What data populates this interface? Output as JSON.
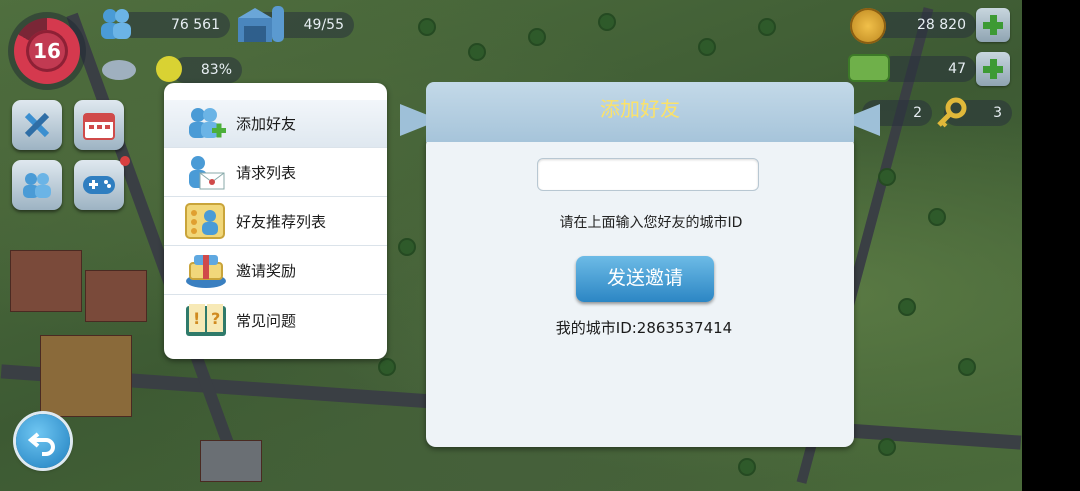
{
  "hud": {
    "level": "16",
    "population": "76 561",
    "storage": "49/55",
    "happiness": "83%",
    "simoleons": "28 820",
    "simcash": "47",
    "golden_keys": "2",
    "keys": "3"
  },
  "menu": {
    "items": [
      {
        "label": "添加好友",
        "icon": "add-friend-icon"
      },
      {
        "label": "请求列表",
        "icon": "request-list-icon"
      },
      {
        "label": "好友推荐列表",
        "icon": "recommend-list-icon"
      },
      {
        "label": "邀请奖励",
        "icon": "invite-reward-icon"
      },
      {
        "label": "常见问题",
        "icon": "faq-book-icon"
      }
    ],
    "active_index": 0
  },
  "dialog": {
    "title": "添加好友",
    "input_value": "",
    "hint": "请在上面输入您好友的城市ID",
    "send_label": "发送邀请",
    "my_city_id": "我的城市ID:2863537414"
  },
  "colors": {
    "title_text": "#fbe26a",
    "send_button": "#2c86c4",
    "level_badge": "#c23a52"
  }
}
